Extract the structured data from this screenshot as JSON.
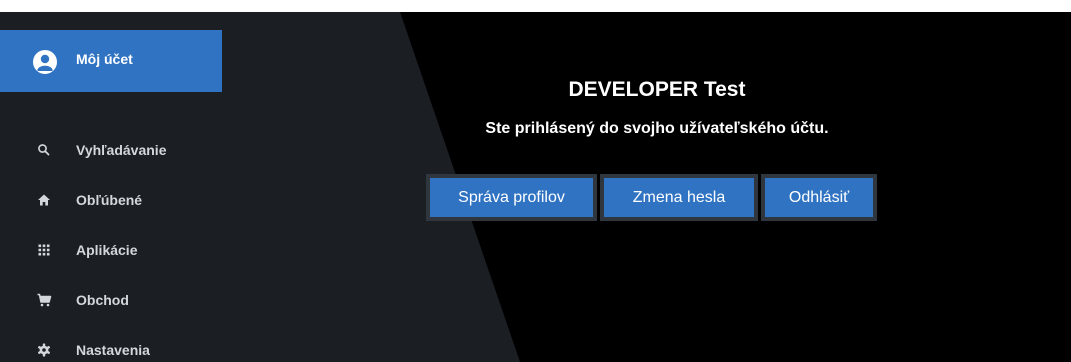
{
  "sidebar": {
    "account": {
      "label": "Môj účet",
      "icon": "account-circle-icon"
    },
    "items": [
      {
        "label": "Vyhľadávanie",
        "icon": "search-icon"
      },
      {
        "label": "Obľúbené",
        "icon": "home-icon"
      },
      {
        "label": "Aplikácie",
        "icon": "apps-grid-icon"
      },
      {
        "label": "Obchod",
        "icon": "shopping-cart-icon"
      },
      {
        "label": "Nastavenia",
        "icon": "gear-icon"
      }
    ]
  },
  "main": {
    "title": "DEVELOPER Test",
    "subtitle": "Ste prihlásený do svojho užívateľského účtu.",
    "buttons": {
      "profiles": "Správa profilov",
      "password": "Zmena hesla",
      "logout": "Odhlásiť"
    }
  },
  "colors": {
    "accent": "#2f73c2",
    "background": "#000000",
    "sidebar": "#1b1f24",
    "button_border": "#30363e"
  }
}
